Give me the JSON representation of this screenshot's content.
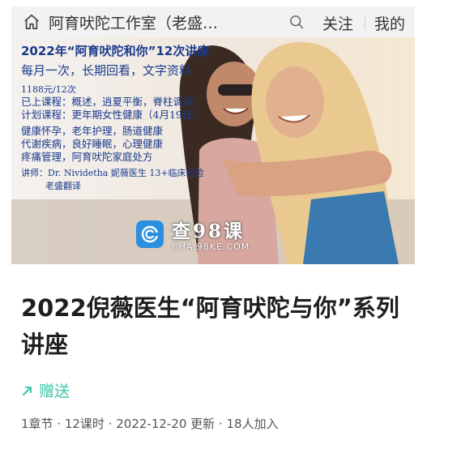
{
  "header": {
    "title": "阿育吠陀工作室（老盛…",
    "follow_label": "关注",
    "mine_label": "我的"
  },
  "banner": {
    "line_title": "2022年“阿育吠陀和你”12次讲座",
    "line_sub": "每月一次，长期回看，文字资料",
    "price": "1188元/12次",
    "done": "已上课程：概述，逍夏平衡，脊柱调理",
    "plan": "计划课程：更年期女性健康（4月19日）",
    "topic1": "健康怀孕，老年护理，肠道健康",
    "topic2": "代谢疾病，良好睡眠，心理健康",
    "topic3": "疼痛管理，阿育吠陀家庭处方",
    "lecturer": "讲师：Dr. Nividetha 妮薇医生 13+临床经验",
    "translator": "老盛翻译",
    "watermark_main": "查98课",
    "watermark_sub": "CHA.98KE.COM"
  },
  "course": {
    "title": "2022倪薇医生“阿育吠陀与你”系列讲座",
    "gift_label": "赠送",
    "meta": "1章节 · 12课时 · 2022-12-20 更新 · 18人加入"
  },
  "colors": {
    "accent_green": "#3cc6a6",
    "banner_text": "#1a3a8c",
    "topbar_bg": "#f2f2f2"
  },
  "icons": {
    "home": "home-icon",
    "search": "search-icon",
    "gift": "arrow-up-right-icon",
    "watermark": "brand-logo-icon"
  }
}
